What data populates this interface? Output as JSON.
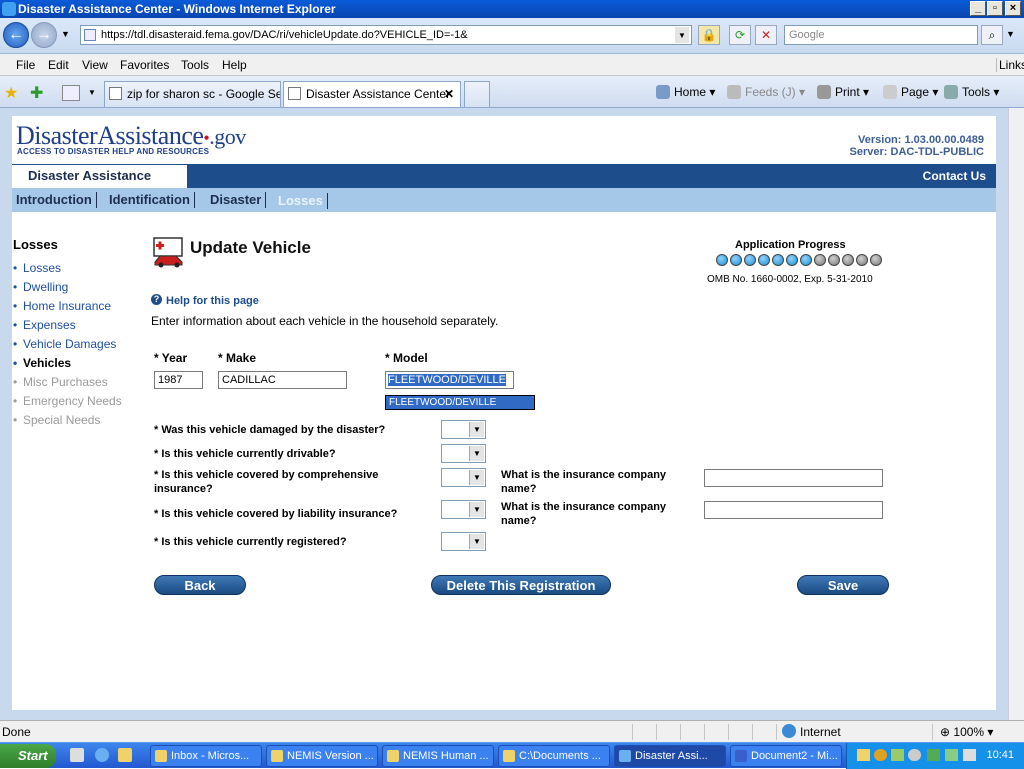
{
  "window": {
    "title": "Disaster Assistance Center - Windows Internet Explorer"
  },
  "addressbar": {
    "url": "https://tdl.disasteraid.fema.gov/DAC/ri/vehicleUpdate.do?VEHICLE_ID=-1&",
    "search_placeholder": "Google"
  },
  "menu": {
    "items": [
      "File",
      "Edit",
      "View",
      "Favorites",
      "Tools",
      "Help"
    ],
    "links": "Links"
  },
  "browser_tabs": [
    {
      "label": "zip for sharon sc - Google Se..."
    },
    {
      "label": "Disaster Assistance Center"
    }
  ],
  "commands": {
    "home": "Home",
    "feeds": "Feeds (J)",
    "print": "Print",
    "page": "Page",
    "tools": "Tools"
  },
  "site": {
    "logo_main": "DisasterAssistance",
    "logo_gov": ".gov",
    "logo_tagline": "ACCESS TO DISASTER HELP AND RESOURCES",
    "version": "Version: 1.03.00.00.0489",
    "server": "Server: DAC-TDL-PUBLIC",
    "section": "Disaster Assistance",
    "contact": "Contact Us"
  },
  "nav_tabs": [
    "Introduction",
    "Identification",
    "Disaster",
    "Losses"
  ],
  "side_nav": {
    "heading": "Losses",
    "items": [
      "Losses",
      "Dwelling",
      "Home Insurance",
      "Expenses",
      "Vehicle Damages",
      "Vehicles",
      "Misc Purchases",
      "Emergency Needs",
      "Special Needs"
    ]
  },
  "main": {
    "title": "Update Vehicle",
    "help": "Help for this page",
    "intro": "Enter information about each vehicle in the household separately.",
    "progress_label": "Application Progress",
    "progress": {
      "completed": 7,
      "total": 12
    },
    "omb": "OMB No. 1660-0002, Exp. 5-31-2010"
  },
  "form": {
    "year_label": "* Year",
    "year_value": "1987",
    "make_label": "* Make",
    "make_value": "CADILLAC",
    "model_label": "* Model",
    "model_value": "FLEETWOOD/DEVILLE",
    "model_suggestion": "FLEETWOOD/DEVILLE",
    "q_damaged": "* Was this vehicle damaged by the disaster?",
    "q_drivable": "* Is this vehicle currently drivable?",
    "q_comprehensive": "* Is this vehicle covered by comprehensive insurance?",
    "q_liability": "* Is this vehicle covered by liability insurance?",
    "q_registered": "* Is this vehicle currently registered?",
    "insurance_company_label": "What is the insurance company name?",
    "back": "Back",
    "delete": "Delete This Registration",
    "save": "Save"
  },
  "statusbar": {
    "status": "Done",
    "zone": "Internet",
    "zoom": "100%"
  },
  "taskbar": {
    "start": "Start",
    "tasks": [
      "Inbox - Micros...",
      "NEMIS Version ...",
      "NEMIS Human ...",
      "C:\\Documents ...",
      "Disaster Assi...",
      "Document2 - Mi..."
    ],
    "clock": "10:41"
  },
  "colors": {
    "brand_blue": "#1d4d8a",
    "nav_light": "#a6c8e8",
    "dot_done": "#1a8fd0",
    "dot_todo": "#777777"
  }
}
